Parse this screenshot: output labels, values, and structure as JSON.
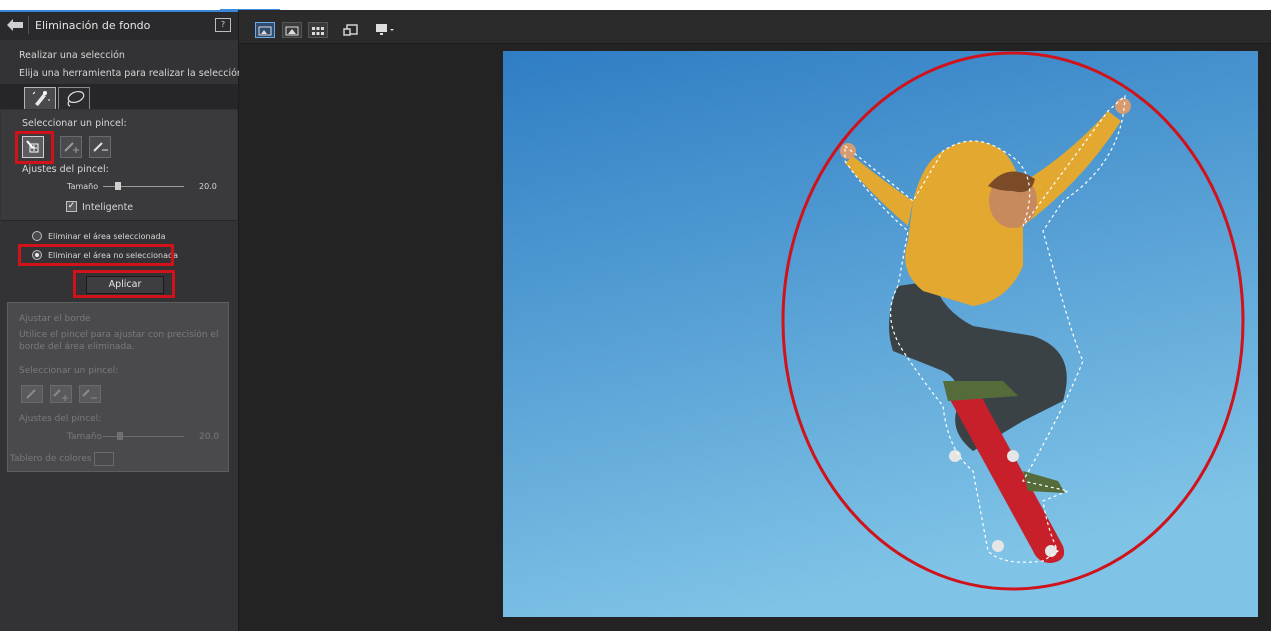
{
  "header": {
    "title": "Eliminación de fondo"
  },
  "selection": {
    "heading": "Realizar una selección",
    "instruction": "Elija una herramienta para realizar la selección:",
    "brush_label": "Seleccionar un pincel:",
    "brush_settings_label": "Ajustes del pincel:",
    "size_label": "Tamaño",
    "size_value": "20.0",
    "size_fraction": 0.2,
    "smart_label": "Inteligente",
    "smart_checked": true
  },
  "options": {
    "remove_selected": "Eliminar el área seleccionada",
    "remove_unselected": "Eliminar el área no seleccionada",
    "selected_option": "remove_unselected",
    "apply_label": "Aplicar"
  },
  "edge": {
    "heading": "Ajustar el borde",
    "description_line1": "Utilice el pincel para ajustar con precisión el",
    "description_line2": "borde del área eliminada.",
    "brush_label": "Seleccionar un pincel:",
    "brush_settings_label": "Ajustes del pincel:",
    "size_label": "Tamaño",
    "size_value": "20.0",
    "color_board_label": "Tablero de colores"
  },
  "colors": {
    "highlight": "#d0121a",
    "sky_top": "#2f7dc4",
    "sky_bottom": "#7fc3e6"
  },
  "canvas": {
    "image_description_icons": [
      "back-arrow-icon",
      "help-icon",
      "magic-brush-icon",
      "lasso-icon"
    ]
  }
}
